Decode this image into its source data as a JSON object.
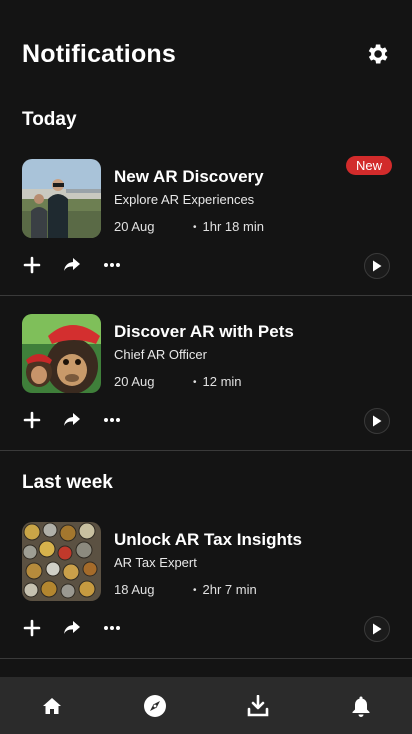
{
  "header": {
    "title": "Notifications",
    "settings_icon": "gear-icon"
  },
  "sections": {
    "today": "Today",
    "last_week": "Last week"
  },
  "notifications": [
    {
      "title": "New AR Discovery",
      "subtitle": "Explore AR Experiences",
      "date": "20 Aug",
      "duration": "1hr 18 min",
      "badge": "New",
      "thumbnail": "people-with-vr-headsets"
    },
    {
      "title": "Discover AR with Pets",
      "subtitle": "Chief AR Officer",
      "date": "20 Aug",
      "duration": "12 min",
      "thumbnail": "monkeys-in-hats"
    },
    {
      "title": "Unlock AR Tax Insights",
      "subtitle": "AR Tax Expert",
      "date": "18 Aug",
      "duration": "2hr 7 min",
      "thumbnail": "pile-of-coins"
    }
  ],
  "icons": {
    "actions": [
      "plus-icon",
      "share-icon",
      "more-icon"
    ],
    "play": "play-icon"
  },
  "bottom_nav": [
    "home-icon",
    "explore-icon",
    "download-icon",
    "bell-icon"
  ],
  "colors": {
    "background": "#141414",
    "badge": "#d22b2b",
    "nav_background": "#2b2b2b",
    "divider": "#3a3a3a"
  }
}
